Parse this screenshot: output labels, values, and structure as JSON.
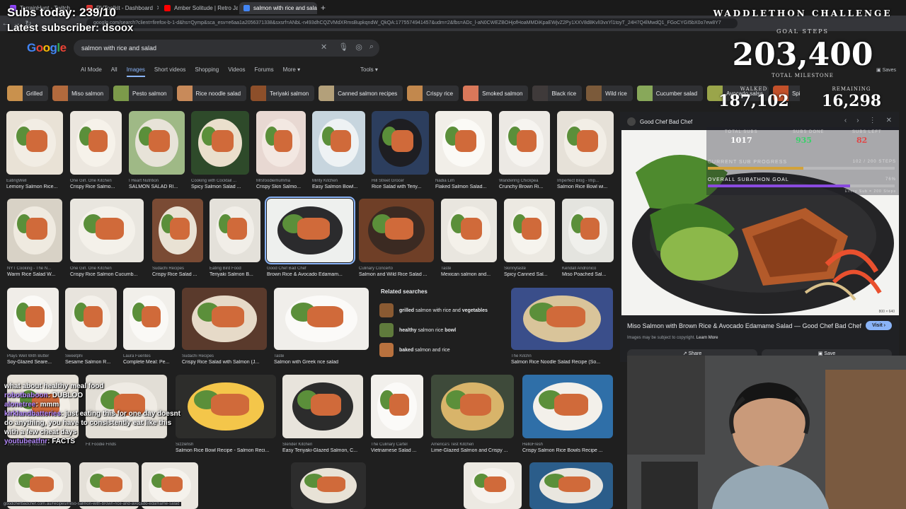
{
  "browser": {
    "tabs": [
      {
        "label": "TerrainHunt - Twitch",
        "color": "#9146ff",
        "active": false
      },
      {
        "label": "RVToolkit - Dashboard",
        "color": "#e53935",
        "active": false
      },
      {
        "label": "Amber Solitude | Retro Jaz",
        "color": "#ff0000",
        "active": false
      },
      {
        "label": "salmon with rice and salad - G",
        "color": "#4285f4",
        "active": true
      }
    ],
    "url": "google.com/search?client=firefox-b-1-d&hs=Qymp&sca_esv=e6aa1a2056371338&sxsrf=ANbL-n493dhCQZVMdXRmsBupkqndW_QkQA:1775574941457&udm=2&fbs=ADc_l-aN0CWEZBOHjofHoaMMDiKpaEWjvZ2Py1XXV8d8KvlI3vxYl1toyT_24H7Q4lMwdQ1_FGoCYGI5bX0o7ew8Y7"
  },
  "google": {
    "logo": "Google",
    "query": "salmon with rice and salad",
    "tabs": [
      "AI Mode",
      "All",
      "Images",
      "Short videos",
      "Shopping",
      "Videos",
      "Forums",
      "More"
    ],
    "active_tab": "Images",
    "tools": "Tools",
    "saves": "Saves"
  },
  "chips": [
    {
      "label": "Grilled",
      "color": "#c9914d"
    },
    {
      "label": "Miso salmon",
      "color": "#b26a3d"
    },
    {
      "label": "Pesto salmon",
      "color": "#7c9a4a"
    },
    {
      "label": "Rice noodle salad",
      "color": "#c88a5a"
    },
    {
      "label": "Teriyaki salmon",
      "color": "#8d4f2a"
    },
    {
      "label": "Canned salmon recipes",
      "color": "#b3a07a"
    },
    {
      "label": "Crispy rice",
      "color": "#c2884d"
    },
    {
      "label": "Smoked salmon",
      "color": "#d9785a"
    },
    {
      "label": "Black rice",
      "color": "#3f3a3a"
    },
    {
      "label": "Wild rice",
      "color": "#7b5a3a"
    },
    {
      "label": "Cucumber salad",
      "color": "#88a85a"
    },
    {
      "label": "Avocado salsa",
      "color": "#9aa54a"
    },
    {
      "label": "Spicy salmon",
      "color": "#c2502a"
    }
  ],
  "results": [
    {
      "src": "EatingWell",
      "title": "Lemony Salmon Rice...",
      "bg": "#e9e2d6",
      "dish": "#f2ede4"
    },
    {
      "src": "One Girl. One Kitchen",
      "title": "Crispy Rice Salmo...",
      "bg": "#ece7df",
      "dish": "#f6f2ea"
    },
    {
      "src": "I Heart Nutrition",
      "title": "SALMON SALAD RI...",
      "bg": "#9fb986",
      "dish": "#e7e3d8"
    },
    {
      "src": "Cooking with Cocktail ...",
      "title": "Spicy Salmon Salad ...",
      "bg": "#2e4a2a",
      "dish": "#eadfcc"
    },
    {
      "src": "Mrsfoodiemumma",
      "title": "Crispy Skin Salmo...",
      "bg": "#e8d8d2",
      "dish": "#f3e8e2"
    },
    {
      "src": "Minty Kitchen",
      "title": "Easy Salmon Bowl...",
      "bg": "#c7d5de",
      "dish": "#eef2f4"
    },
    {
      "src": "Hill Street Grocer",
      "title": "Rice Salad with Teriy...",
      "bg": "#2c3e5e",
      "dish": "#1e1e22"
    },
    {
      "src": "Nadia Lim",
      "title": "Flaked Salmon Salad...",
      "bg": "#f1eee8",
      "dish": "#fbfaf6"
    },
    {
      "src": "Wandering Chickpea",
      "title": "Crunchy Brown Ri...",
      "bg": "#ece9e4",
      "dish": "#f6f4f0"
    },
    {
      "src": "Imperfect Blog - Imp...",
      "title": "Salmon Rice Bowl wi...",
      "bg": "#e6e1d8",
      "dish": "#f2eee6"
    },
    {
      "src": "NYT Cooking - The N...",
      "title": "Warm Rice Salad W...",
      "bg": "#d8d2c6",
      "dish": "#efeae0"
    },
    {
      "src": "One Girl. One Kitchen",
      "title": "Crispy Rice Salmon Cucumb...",
      "bg": "#e9e6df",
      "dish": "#f4f1ea"
    },
    {
      "src": "Sudachi Recipes",
      "title": "Crispy Rice Salad ...",
      "bg": "#7a4b34",
      "dish": "#e9e2d4"
    },
    {
      "src": "Eating Bird Food",
      "title": "Teriyaki Salmon B...",
      "bg": "#e4e1da",
      "dish": "#f1eee8"
    },
    {
      "src": "Good Chef Bad Chef",
      "title": "Brown Rice & Avocado Edamam...",
      "bg": "#eef0ee",
      "dish": "#2b2b2d"
    },
    {
      "src": "Culinary Concerto",
      "title": "Salmon and Wild Rice Salad ...",
      "bg": "#6f3f27",
      "dish": "#3b2a22"
    },
    {
      "src": "Taste",
      "title": "Mexican salmon and...",
      "bg": "#e9e6df",
      "dish": "#f4f1ea"
    },
    {
      "src": "Skinnytaste",
      "title": "Spicy Canned Sal...",
      "bg": "#ece9e2",
      "dish": "#f6f4ee"
    },
    {
      "src": "Kendall Andronico",
      "title": "Miso Poached Sal...",
      "bg": "#e4e4df",
      "dish": "#f0f0ec"
    },
    {
      "src": "Plays Well With Butter",
      "title": "Soy-Glazed Seare...",
      "bg": "#f0ede8",
      "dish": "#fbfaf7"
    },
    {
      "src": "Sweetphi",
      "title": "Sesame Salmon R...",
      "bg": "#e8e4dd",
      "dish": "#f4f1eb"
    },
    {
      "src": "Laura Fuentes",
      "title": "Complete Meal: Pe...",
      "bg": "#f1efea",
      "dish": "#faf9f6"
    },
    {
      "src": "Sudachi Recipes",
      "title": "Crispy Rice Salad with Salmon (J...",
      "bg": "#5a3a2c",
      "dish": "#e6dac8"
    },
    {
      "src": "Taste",
      "title": "Salmon with Greek rice salad",
      "bg": "#f0eeea",
      "dish": "#fbfaf8"
    },
    {
      "src": "The Kitchn",
      "title": "Salmon Rice Noodle Salad Recipe (So...",
      "bg": "#3a4e8a",
      "dish": "#d9c49a"
    },
    {
      "src": "The Anthony Kitchen",
      "title": "",
      "bg": "#e6e1d8",
      "dish": "#f2eee6"
    },
    {
      "src": "Fit Foodie Finds",
      "title": "",
      "bg": "#e2ded6",
      "dish": "#efebe4"
    },
    {
      "src": "Sizzlefish",
      "title": "Salmon Rice Bowl Recipe - Salmon Reci...",
      "bg": "#2d2d2b",
      "dish": "#f4c64a"
    },
    {
      "src": "Slender Kitchen",
      "title": "Easy Teriyaki-Glazed Salmon, C...",
      "bg": "#e8e4dc",
      "dish": "#2c2c2c"
    },
    {
      "src": "The Culinary Cartel",
      "title": "Vietnamese Salad ...",
      "bg": "#f2f0ec",
      "dish": "#fbfaf8"
    },
    {
      "src": "America's Test Kitchen",
      "title": "Lime-Glazed Salmon and Crispy ...",
      "bg": "#3e4a3a",
      "dish": "#d8b46a"
    },
    {
      "src": "HelloFresh",
      "title": "Crispy Salmon Rice Bowls Recipe ...",
      "bg": "#2f6fa8",
      "dish": "#f3f0ea"
    },
    {
      "src": "",
      "title": "",
      "bg": "#e7e3dc",
      "dish": "#f2efe8"
    },
    {
      "src": "",
      "title": "",
      "bg": "#e4e0d8",
      "dish": "#f1ede6"
    },
    {
      "src": "",
      "title": "",
      "bg": "#ebe7e0",
      "dish": "#f5f2ec"
    },
    {
      "src": "",
      "title": "",
      "bg": "#2d2d2d",
      "dish": "#e8e2d6"
    },
    {
      "src": "",
      "title": "",
      "bg": "#ece9e2",
      "dish": "#f6f3ee"
    },
    {
      "src": "",
      "title": "",
      "bg": "#2b5d8a",
      "dish": "#e9e6df"
    }
  ],
  "related": {
    "title": "Related searches",
    "items": [
      {
        "bold": "grilled",
        "rest": " salmon with rice and ",
        "bold2": "vegetables"
      },
      {
        "bold": "healthy",
        "rest": " salmon rice ",
        "bold2": "bowl"
      },
      {
        "bold": "baked",
        "rest": " salmon and rice",
        "bold2": ""
      }
    ]
  },
  "preview": {
    "source": "Good Chef Bad Chef",
    "title": "Miso Salmon with Brown Rice & Avocado Edamame Salad — Good Chef Bad Chef",
    "visit": "Visit",
    "copyright": "Images may be subject to copyright.",
    "learn_more": "Learn More",
    "share": "Share",
    "save": "Save",
    "size": "800 × 640"
  },
  "overlay": {
    "subs": "Subs today: 239/10",
    "latest": "Latest subscriber: dsoox",
    "challenge": "WADDLETHON CHALLENGE",
    "goal_label": "GOAL STEPS",
    "goal": "203,400",
    "milestone": "TOTAL MILESTONE",
    "walked_label": "WALKED",
    "walked": "187,102",
    "remaining_label": "REMAINING",
    "remaining": "16,298",
    "subgoal": {
      "col_labels": [
        "TOTAL SUBS",
        "SUBS DONE",
        "SUBS LEFT"
      ],
      "values": [
        "1017",
        "935",
        "82"
      ],
      "value_colors": [
        "#ffffff",
        "#38d26a",
        "#e04848"
      ],
      "current_label": "CURRENT SUB PROGRESS",
      "current_right": "102 / 200 STEPS",
      "current_fraction": 0.51,
      "overall_label": "OVERALL SUBATHON GOAL",
      "overall_right": "76%",
      "overall_fraction": 0.76,
      "footnote": "Every Sub = 200 Steps"
    },
    "chat": [
      {
        "name": "",
        "text": "what about healthy meal food"
      },
      {
        "name": "robotbaboon",
        "text": "DUBLOO"
      },
      {
        "name": "alonetree",
        "text": "mmm"
      },
      {
        "name": "kirklandbatteries",
        "text": "just eating this for one day doesnt do anything, you have to consistently eat like this with a few cheat days"
      },
      {
        "name": "youtubeatfnr",
        "text": "FACTS"
      }
    ]
  },
  "status_url": "goodchefbadchef.com.au/recipes/miso-salmon-with-brown-rice-and-avocado-edamame-salad"
}
